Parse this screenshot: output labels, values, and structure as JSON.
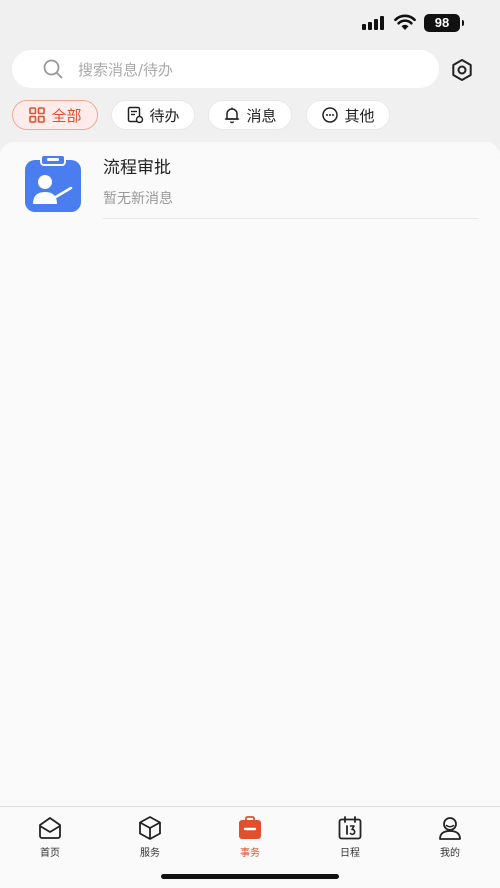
{
  "status_bar": {
    "battery": "98"
  },
  "search": {
    "placeholder": "搜索消息/待办"
  },
  "filters": [
    {
      "label": "全部",
      "icon": "grid-icon",
      "active": true
    },
    {
      "label": "待办",
      "icon": "todo-icon",
      "active": false
    },
    {
      "label": "消息",
      "icon": "bell-icon",
      "active": false
    },
    {
      "label": "其他",
      "icon": "more-icon",
      "active": false
    }
  ],
  "messages": [
    {
      "title": "流程审批",
      "subtitle": "暂无新消息",
      "icon": "approval-icon"
    }
  ],
  "tabbar": [
    {
      "label": "首页",
      "icon": "home-icon",
      "active": false
    },
    {
      "label": "服务",
      "icon": "cube-icon",
      "active": false
    },
    {
      "label": "事务",
      "icon": "briefcase-icon",
      "active": true
    },
    {
      "label": "日程",
      "icon": "calendar-icon",
      "active": false
    },
    {
      "label": "我的",
      "icon": "profile-icon",
      "active": false
    }
  ],
  "colors": {
    "accent": "#e0502c",
    "avatar_blue": "#4a7df0"
  }
}
